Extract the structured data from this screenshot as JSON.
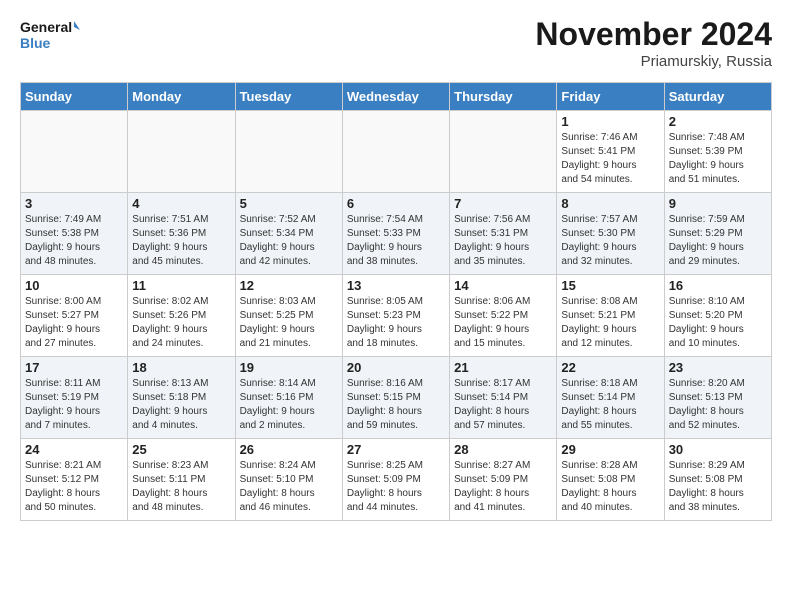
{
  "header": {
    "logo_line1": "General",
    "logo_line2": "Blue",
    "month_title": "November 2024",
    "location": "Priamurskiy, Russia"
  },
  "weekdays": [
    "Sunday",
    "Monday",
    "Tuesday",
    "Wednesday",
    "Thursday",
    "Friday",
    "Saturday"
  ],
  "weeks": [
    [
      {
        "day": "",
        "text": ""
      },
      {
        "day": "",
        "text": ""
      },
      {
        "day": "",
        "text": ""
      },
      {
        "day": "",
        "text": ""
      },
      {
        "day": "",
        "text": ""
      },
      {
        "day": "1",
        "text": "Sunrise: 7:46 AM\nSunset: 5:41 PM\nDaylight: 9 hours\nand 54 minutes."
      },
      {
        "day": "2",
        "text": "Sunrise: 7:48 AM\nSunset: 5:39 PM\nDaylight: 9 hours\nand 51 minutes."
      }
    ],
    [
      {
        "day": "3",
        "text": "Sunrise: 7:49 AM\nSunset: 5:38 PM\nDaylight: 9 hours\nand 48 minutes."
      },
      {
        "day": "4",
        "text": "Sunrise: 7:51 AM\nSunset: 5:36 PM\nDaylight: 9 hours\nand 45 minutes."
      },
      {
        "day": "5",
        "text": "Sunrise: 7:52 AM\nSunset: 5:34 PM\nDaylight: 9 hours\nand 42 minutes."
      },
      {
        "day": "6",
        "text": "Sunrise: 7:54 AM\nSunset: 5:33 PM\nDaylight: 9 hours\nand 38 minutes."
      },
      {
        "day": "7",
        "text": "Sunrise: 7:56 AM\nSunset: 5:31 PM\nDaylight: 9 hours\nand 35 minutes."
      },
      {
        "day": "8",
        "text": "Sunrise: 7:57 AM\nSunset: 5:30 PM\nDaylight: 9 hours\nand 32 minutes."
      },
      {
        "day": "9",
        "text": "Sunrise: 7:59 AM\nSunset: 5:29 PM\nDaylight: 9 hours\nand 29 minutes."
      }
    ],
    [
      {
        "day": "10",
        "text": "Sunrise: 8:00 AM\nSunset: 5:27 PM\nDaylight: 9 hours\nand 27 minutes."
      },
      {
        "day": "11",
        "text": "Sunrise: 8:02 AM\nSunset: 5:26 PM\nDaylight: 9 hours\nand 24 minutes."
      },
      {
        "day": "12",
        "text": "Sunrise: 8:03 AM\nSunset: 5:25 PM\nDaylight: 9 hours\nand 21 minutes."
      },
      {
        "day": "13",
        "text": "Sunrise: 8:05 AM\nSunset: 5:23 PM\nDaylight: 9 hours\nand 18 minutes."
      },
      {
        "day": "14",
        "text": "Sunrise: 8:06 AM\nSunset: 5:22 PM\nDaylight: 9 hours\nand 15 minutes."
      },
      {
        "day": "15",
        "text": "Sunrise: 8:08 AM\nSunset: 5:21 PM\nDaylight: 9 hours\nand 12 minutes."
      },
      {
        "day": "16",
        "text": "Sunrise: 8:10 AM\nSunset: 5:20 PM\nDaylight: 9 hours\nand 10 minutes."
      }
    ],
    [
      {
        "day": "17",
        "text": "Sunrise: 8:11 AM\nSunset: 5:19 PM\nDaylight: 9 hours\nand 7 minutes."
      },
      {
        "day": "18",
        "text": "Sunrise: 8:13 AM\nSunset: 5:18 PM\nDaylight: 9 hours\nand 4 minutes."
      },
      {
        "day": "19",
        "text": "Sunrise: 8:14 AM\nSunset: 5:16 PM\nDaylight: 9 hours\nand 2 minutes."
      },
      {
        "day": "20",
        "text": "Sunrise: 8:16 AM\nSunset: 5:15 PM\nDaylight: 8 hours\nand 59 minutes."
      },
      {
        "day": "21",
        "text": "Sunrise: 8:17 AM\nSunset: 5:14 PM\nDaylight: 8 hours\nand 57 minutes."
      },
      {
        "day": "22",
        "text": "Sunrise: 8:18 AM\nSunset: 5:14 PM\nDaylight: 8 hours\nand 55 minutes."
      },
      {
        "day": "23",
        "text": "Sunrise: 8:20 AM\nSunset: 5:13 PM\nDaylight: 8 hours\nand 52 minutes."
      }
    ],
    [
      {
        "day": "24",
        "text": "Sunrise: 8:21 AM\nSunset: 5:12 PM\nDaylight: 8 hours\nand 50 minutes."
      },
      {
        "day": "25",
        "text": "Sunrise: 8:23 AM\nSunset: 5:11 PM\nDaylight: 8 hours\nand 48 minutes."
      },
      {
        "day": "26",
        "text": "Sunrise: 8:24 AM\nSunset: 5:10 PM\nDaylight: 8 hours\nand 46 minutes."
      },
      {
        "day": "27",
        "text": "Sunrise: 8:25 AM\nSunset: 5:09 PM\nDaylight: 8 hours\nand 44 minutes."
      },
      {
        "day": "28",
        "text": "Sunrise: 8:27 AM\nSunset: 5:09 PM\nDaylight: 8 hours\nand 41 minutes."
      },
      {
        "day": "29",
        "text": "Sunrise: 8:28 AM\nSunset: 5:08 PM\nDaylight: 8 hours\nand 40 minutes."
      },
      {
        "day": "30",
        "text": "Sunrise: 8:29 AM\nSunset: 5:08 PM\nDaylight: 8 hours\nand 38 minutes."
      }
    ]
  ]
}
